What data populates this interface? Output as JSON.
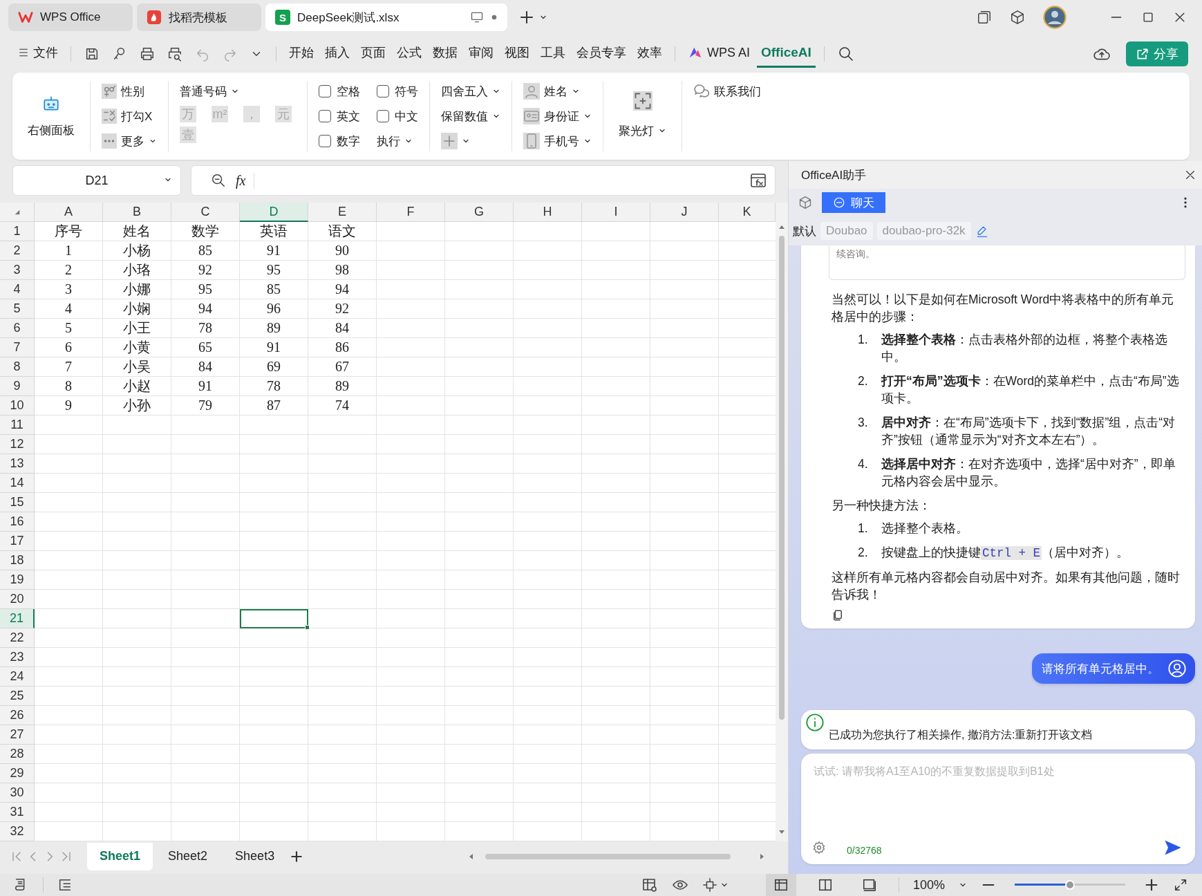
{
  "title_bar": {
    "tabs": [
      {
        "kind": "wps",
        "label": "WPS Office",
        "selected": false
      },
      {
        "kind": "template",
        "label": "找稻壳模板",
        "selected": false
      },
      {
        "kind": "sheet",
        "logo_letter": "S",
        "label": "DeepSeek测试.xlsx",
        "selected": true
      }
    ]
  },
  "menu_bar": {
    "file": "文件",
    "items": [
      {
        "kind": "plain",
        "label": "开始",
        "selected": false
      },
      {
        "kind": "plain",
        "label": "插入",
        "selected": false
      },
      {
        "kind": "plain",
        "label": "页面",
        "selected": false
      },
      {
        "kind": "plain",
        "label": "公式",
        "selected": false
      },
      {
        "kind": "plain",
        "label": "数据",
        "selected": false
      },
      {
        "kind": "plain",
        "label": "审阅",
        "selected": false
      },
      {
        "kind": "plain",
        "label": "视图",
        "selected": false
      },
      {
        "kind": "plain",
        "label": "工具",
        "selected": false
      },
      {
        "kind": "plain",
        "label": "会员专享",
        "selected": false
      },
      {
        "kind": "plain",
        "label": "效率",
        "selected": false
      },
      {
        "kind": "ai",
        "label": "WPS AI",
        "selected": false
      },
      {
        "kind": "plain",
        "label": "OfficeAI",
        "selected": true
      }
    ],
    "share": "分享"
  },
  "ribbon": {
    "panel_button": "右侧面板",
    "marks": [
      {
        "kind": "gender",
        "label": "性别",
        "caret": false
      },
      {
        "kind": "tick",
        "label": "打勾X",
        "caret": false
      },
      {
        "kind": "more",
        "label": "更多",
        "caret": true
      }
    ],
    "number_format": {
      "label": "普通号码",
      "symbols": [
        {
          "text": "万",
          "disabled": true
        },
        {
          "text": "m²",
          "disabled": true
        },
        {
          "text": "，",
          "disabled": true
        },
        {
          "text": "元",
          "disabled": true
        },
        {
          "text": "壹",
          "disabled": true
        }
      ]
    },
    "checkboxes": [
      {
        "label": "空格",
        "checked": false
      },
      {
        "label": "符号",
        "checked": false
      },
      {
        "label": "英文",
        "checked": false
      },
      {
        "label": "中文",
        "checked": false
      },
      {
        "label": "数字",
        "checked": false
      }
    ],
    "execute": "执行",
    "rounding": [
      {
        "label": "四舍五入"
      },
      {
        "label": "保留数值"
      }
    ],
    "privacy": [
      {
        "kind": "person",
        "label": "姓名"
      },
      {
        "kind": "id_card",
        "label": "身份证"
      },
      {
        "kind": "phone",
        "label": "手机号"
      }
    ],
    "spotlight": "聚光灯",
    "contact": "联系我们"
  },
  "formula_bar": {
    "name_box": "D21",
    "fx": "fx"
  },
  "sheet": {
    "columns": [
      {
        "label": "A",
        "selected": false
      },
      {
        "label": "B",
        "selected": false
      },
      {
        "label": "C",
        "selected": false
      },
      {
        "label": "D",
        "selected": true
      },
      {
        "label": "E",
        "selected": false
      },
      {
        "label": "F",
        "selected": false
      },
      {
        "label": "G",
        "selected": false
      },
      {
        "label": "H",
        "selected": false
      },
      {
        "label": "I",
        "selected": false
      },
      {
        "label": "J",
        "selected": false
      },
      {
        "label": "K",
        "selected": false
      }
    ],
    "rows": [
      {
        "number": "1",
        "selected": false,
        "cells": [
          "序号",
          "姓名",
          "数学",
          "英语",
          "语文"
        ]
      },
      {
        "number": "2",
        "selected": false,
        "cells": [
          "1",
          "小杨",
          "85",
          "91",
          "90"
        ]
      },
      {
        "number": "3",
        "selected": false,
        "cells": [
          "2",
          "小珞",
          "92",
          "95",
          "98"
        ]
      },
      {
        "number": "4",
        "selected": false,
        "cells": [
          "3",
          "小娜",
          "95",
          "85",
          "94"
        ]
      },
      {
        "number": "5",
        "selected": false,
        "cells": [
          "4",
          "小娴",
          "94",
          "96",
          "92"
        ]
      },
      {
        "number": "6",
        "selected": false,
        "cells": [
          "5",
          "小王",
          "78",
          "89",
          "84"
        ]
      },
      {
        "number": "7",
        "selected": false,
        "cells": [
          "6",
          "小黄",
          "65",
          "91",
          "86"
        ]
      },
      {
        "number": "8",
        "selected": false,
        "cells": [
          "7",
          "小吴",
          "84",
          "69",
          "67"
        ]
      },
      {
        "number": "9",
        "selected": false,
        "cells": [
          "8",
          "小赵",
          "91",
          "78",
          "89"
        ]
      },
      {
        "number": "10",
        "selected": false,
        "cells": [
          "9",
          "小孙",
          "79",
          "87",
          "74"
        ]
      },
      {
        "number": "11",
        "selected": false
      },
      {
        "number": "12",
        "selected": false
      },
      {
        "number": "13",
        "selected": false
      },
      {
        "number": "14",
        "selected": false
      },
      {
        "number": "15",
        "selected": false
      },
      {
        "number": "16",
        "selected": false
      },
      {
        "number": "17",
        "selected": false
      },
      {
        "number": "18",
        "selected": false
      },
      {
        "number": "19",
        "selected": false
      },
      {
        "number": "20",
        "selected": false
      },
      {
        "number": "21",
        "selected": true
      },
      {
        "number": "22",
        "selected": false
      },
      {
        "number": "23",
        "selected": false
      },
      {
        "number": "24",
        "selected": false
      },
      {
        "number": "25",
        "selected": false
      },
      {
        "number": "26",
        "selected": false
      },
      {
        "number": "27",
        "selected": false
      },
      {
        "number": "28",
        "selected": false
      },
      {
        "number": "29",
        "selected": false
      },
      {
        "number": "30",
        "selected": false
      },
      {
        "number": "31",
        "selected": false
      },
      {
        "number": "32",
        "selected": false
      }
    ],
    "tabs": [
      {
        "label": "Sheet1",
        "selected": true
      },
      {
        "label": "Sheet2",
        "selected": false
      },
      {
        "label": "Sheet3",
        "selected": false
      }
    ]
  },
  "status_bar": {
    "views": [
      {
        "kind": "normal",
        "selected": true
      },
      {
        "kind": "split",
        "selected": false
      },
      {
        "kind": "layout",
        "selected": false
      }
    ],
    "zoom": "100%",
    "zoom_slider": {
      "level": 0.5
    }
  },
  "assistant": {
    "title": "OfficeAI助手",
    "tabs": [
      {
        "label": "聊天",
        "selected": true
      }
    ],
    "model_label": "默认",
    "models": [
      {
        "label": "Doubao"
      },
      {
        "label": "doubao-pro-32k"
      }
    ],
    "answer": [
      {
        "kind": "quote",
        "text": "续咨询。"
      },
      {
        "kind": "paragraph",
        "text": "当然可以！以下是如何在Microsoft Word中将表格中的所有单元格居中的步骤："
      },
      {
        "kind": "list",
        "items": [
          {
            "number": "1.",
            "text": "**选择整个表格**：点击表格外部的边框，将整个表格选中。"
          },
          {
            "number": "2.",
            "text": "**打开“布局”选项卡**：在Word的菜单栏中，点击“布局”选项卡。"
          },
          {
            "number": "3.",
            "text": "**居中对齐**：在“布局”选项卡下，找到“数据”组，点击“对齐”按钮（通常显示为“对齐文本左右”）。"
          },
          {
            "number": "4.",
            "text": "**选择居中对齐**：在对齐选项中，选择“居中对齐”，即单元格内容会居中显示。"
          }
        ]
      },
      {
        "kind": "paragraph",
        "text": "另一种快捷方法："
      },
      {
        "kind": "list",
        "items": [
          {
            "number": "1.",
            "text": "选择整个表格。"
          },
          {
            "number": "2.",
            "text": "按键盘上的快捷键",
            "code": "Ctrl + E",
            "after": "（居中对齐）。"
          }
        ]
      },
      {
        "kind": "paragraph",
        "text": "这样所有单元格内容都会自动居中对齐。如果有其他问题，随时告诉我！"
      }
    ],
    "user_message": "请将所有单元格居中。",
    "notice": "已成功为您执行了相关操作, 撤消方法:重新打开该文档",
    "input": {
      "placeholder": "试试: 请帮我将A1至A10的不重复数据提取到B1处",
      "counter": "0/32768"
    }
  }
}
